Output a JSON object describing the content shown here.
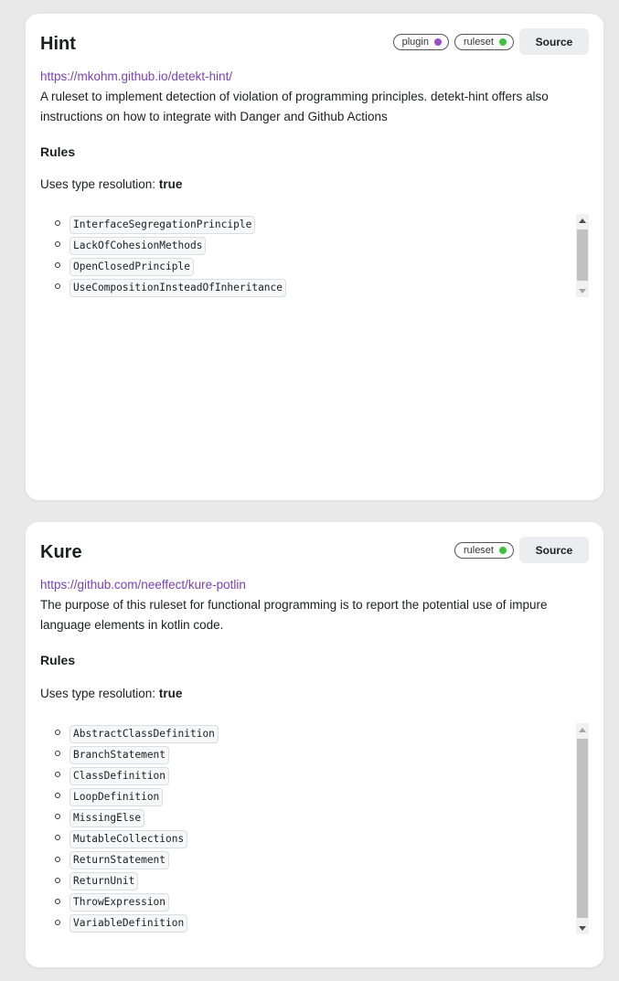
{
  "cards": [
    {
      "title": "Hint",
      "tags": [
        {
          "label": "plugin",
          "color": "#9b4dca"
        },
        {
          "label": "ruleset",
          "color": "#3ec13e"
        }
      ],
      "source_label": "Source",
      "link": "https://mkohm.github.io/detekt-hint/",
      "description": "A ruleset to implement detection of violation of programming principles. detekt-hint offers also instructions on how to integrate with Danger and Github Actions",
      "rules_heading": "Rules",
      "type_resolution_label": "Uses type resolution:",
      "type_resolution_value": "true",
      "rules": [
        "InterfaceSegregationPrinciple",
        "LackOfCohesionMethods",
        "OpenClosedPrinciple",
        "UseCompositionInsteadOfInheritance"
      ]
    },
    {
      "title": "Kure",
      "tags": [
        {
          "label": "ruleset",
          "color": "#3ec13e"
        }
      ],
      "source_label": "Source",
      "link": "https://github.com/neeffect/kure-potlin",
      "description": "The purpose of this ruleset for functional programming is to report the potential use of impure language elements in kotlin code.",
      "rules_heading": "Rules",
      "type_resolution_label": "Uses type resolution:",
      "type_resolution_value": "true",
      "rules": [
        "AbstractClassDefinition",
        "BranchStatement",
        "ClassDefinition",
        "LoopDefinition",
        "MissingElse",
        "MutableCollections",
        "ReturnStatement",
        "ReturnUnit",
        "ThrowExpression",
        "VariableDefinition"
      ]
    }
  ]
}
